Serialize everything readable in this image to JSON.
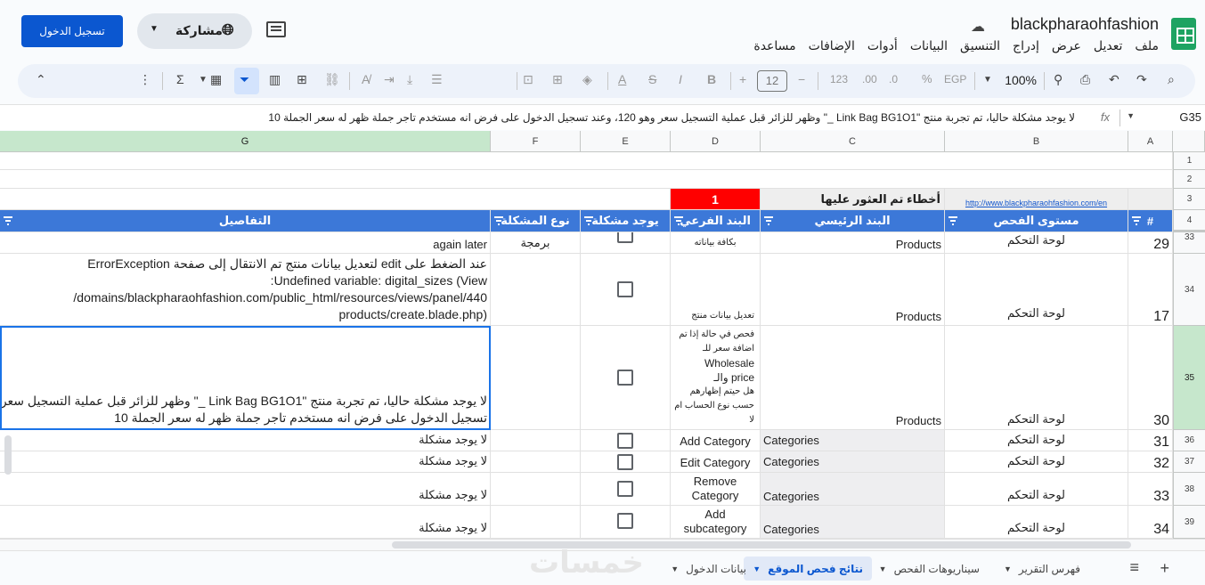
{
  "header": {
    "doc_title": "blackpharaohfashion",
    "login_label": "تسجيل الدخول",
    "share_label": "مشاركة",
    "menu": [
      "ملف",
      "تعديل",
      "عرض",
      "إدراج",
      "التنسيق",
      "البيانات",
      "أدوات",
      "الإضافات",
      "مساعدة"
    ]
  },
  "toolbar": {
    "zoom": "100%",
    "font_size": "12",
    "currency": "EGP",
    "percent": "%",
    "dec_inc": ".00",
    "dec_dec": ".0",
    "num_format": "123"
  },
  "formula_bar": {
    "cell_ref": "G35",
    "fx": "fx",
    "content": "لا يوجد مشكلة حاليا، تم تجربة منتج \"Link Bag BG1O1 _\" وظهر للزائر قبل عملية التسجيل سعر وهو 120، وعند تسجيل الدخول على فرض انه مستخدم تاجر جملة ظهر له سعر الجملة 10"
  },
  "columns": [
    "A",
    "B",
    "C",
    "D",
    "E",
    "F",
    "G"
  ],
  "rows_top": [
    "1",
    "2",
    "3",
    "4"
  ],
  "row3": {
    "link": "http://www.blackpharaohfashion.com/en",
    "errors_found_label": "أخطاء تم العثور عليها",
    "errors_count": "1"
  },
  "table_header": {
    "num": "#",
    "level": "مستوى الفحص",
    "main_item": "البند الرئيسي",
    "sub_item": "البند الفرعي",
    "has_issue": "يوجد مشكلة",
    "issue_type": "نوع المشكلة",
    "details": "التفاصيل"
  },
  "rows": [
    {
      "row_num": "33",
      "num": "29",
      "level": "لوحة التحكم",
      "main": "Products",
      "sub": "بكافة بياناته",
      "type": "برمجة",
      "details": "again later"
    },
    {
      "row_num": "34",
      "num": "17",
      "level": "لوحة التحكم",
      "main": "Products",
      "sub": "تعديل بيانات منتج",
      "type": "",
      "details_lines": [
        "عند الضغط على edit لتعديل بيانات منتج تم الانتقال إلى صفحة ErrorException",
        "Undefined variable: digital_sizes (View:",
        "440/domains/blackpharaohfashion.com/public_html/resources/views/panel/",
        "(products/create.blade.php"
      ]
    },
    {
      "row_num": "35",
      "num": "30",
      "level": "لوحة التحكم",
      "main": "Products",
      "sub_lines": [
        "فحص في حالة إذا تم",
        "اضافة سعر للـ",
        "Wholesale",
        "price والـ",
        "هل حيتم إظهارهم",
        "حسب نوع الحساب ام",
        "لا"
      ],
      "type": "",
      "details_lines": [
        "لا يوجد مشكلة حاليا، تم تجربة منتج \"Link Bag BG1O1 _\" وظهر للزائر قبل عملية التسجيل سعر و",
        "تسجيل الدخول على فرض انه مستخدم تاجر جملة ظهر له سعر الجملة 10"
      ]
    },
    {
      "row_num": "36",
      "num": "31",
      "level": "لوحة التحكم",
      "main": "Categories",
      "sub": "Add Category",
      "type": "",
      "details": "لا يوجد مشكلة"
    },
    {
      "row_num": "37",
      "num": "32",
      "level": "لوحة التحكم",
      "main": "Categories",
      "sub": "Edit Category",
      "type": "",
      "details": "لا يوجد مشكلة"
    },
    {
      "row_num": "38",
      "num": "33",
      "level": "لوحة التحكم",
      "main": "Categories",
      "sub_lines": [
        "Remove",
        "Category"
      ],
      "type": "",
      "details": "لا يوجد مشكلة"
    },
    {
      "row_num": "39",
      "num": "34",
      "level": "لوحة التحكم",
      "main": "Categories",
      "sub_lines": [
        "Add",
        "subcategory"
      ],
      "type": "",
      "details": "لا يوجد مشكلة"
    }
  ],
  "tabs": [
    "فهرس التقرير",
    "سيناريوهات الفحص",
    "نتائج فحص الموقع",
    "بيانات الدخول"
  ],
  "watermark": "خمسات"
}
